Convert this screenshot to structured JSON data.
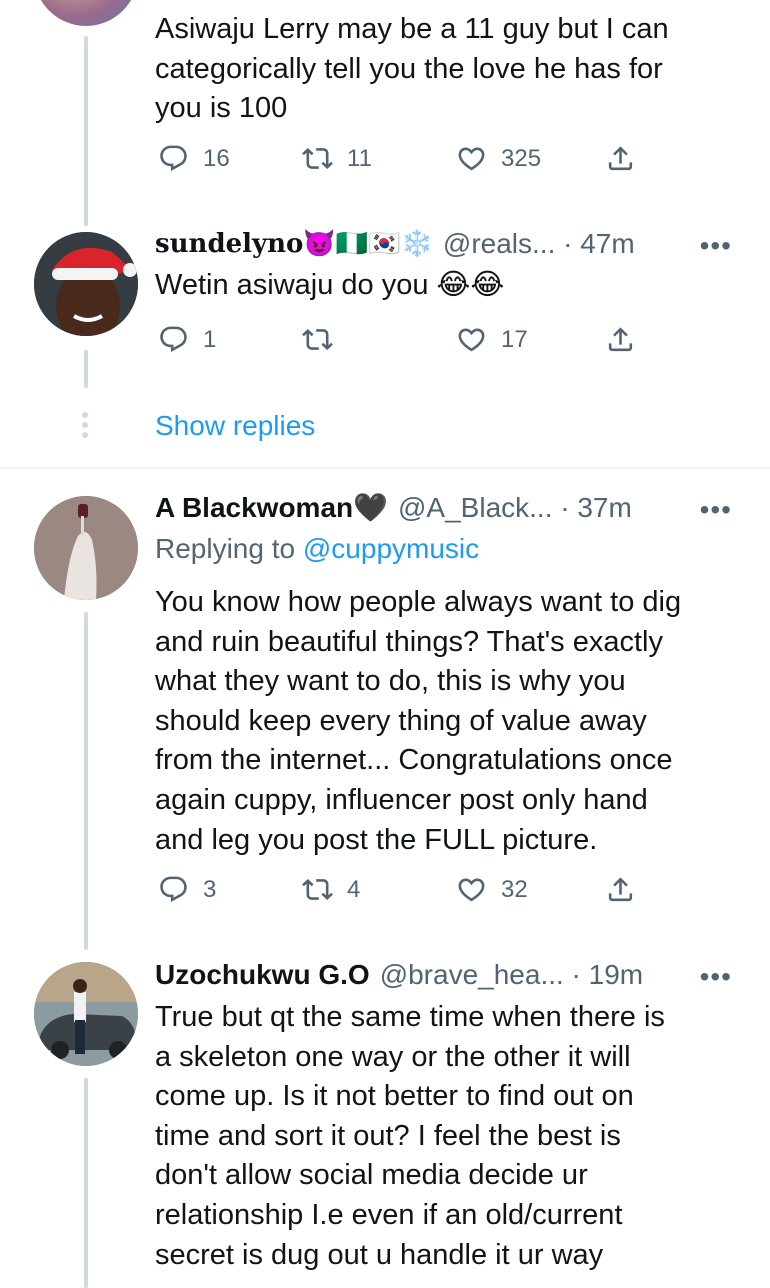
{
  "tweets": [
    {
      "text": "Asiwaju Lerry may be a 11 guy but I can\ncategorically tell you the love he has for\nyou is 100",
      "replies": "16",
      "retweets": "11",
      "likes": "325"
    },
    {
      "name": "sundelyno😈🇳🇬🇰🇷❄️",
      "handle": "@reals... · 47m",
      "more": "•••",
      "text": "Wetin asiwaju do you 😂😂",
      "replies": "1",
      "retweets": "",
      "likes": "17"
    },
    {
      "name": "A Blackwoman🖤",
      "handle": "@A_Black... · 37m",
      "more": "•••",
      "replying_prefix": "Replying to ",
      "replying_to": "@cuppymusic",
      "text": "You know how people always want to dig\nand ruin beautiful things? That's exactly\nwhat they want to do, this is why you\nshould keep every thing of value away\nfrom the internet... Congratulations once\nagain cuppy, influencer post only hand\nand leg you post the FULL picture.",
      "replies": "3",
      "retweets": "4",
      "likes": "32"
    },
    {
      "name": "Uzochukwu G.O",
      "handle": "@brave_hea... · 19m",
      "more": "•••",
      "text": "True but qt the same time when there is\na skeleton one way or the other it will\ncome up. Is it not better to find out on\ntime and sort it out? I feel the best is\ndon't allow social media decide ur\nrelationship I.e even if an old/current\nsecret is dug out u handle it ur way"
    }
  ],
  "show_replies": "Show replies",
  "icons": {
    "reply": "reply-icon",
    "retweet": "retweet-icon",
    "like": "heart-icon",
    "share": "share-icon",
    "more": "more-icon",
    "expand": "vertical-dots-icon"
  },
  "colors": {
    "link": "#1d9bf0",
    "secondary": "#536471",
    "line": "#cfd9de"
  }
}
